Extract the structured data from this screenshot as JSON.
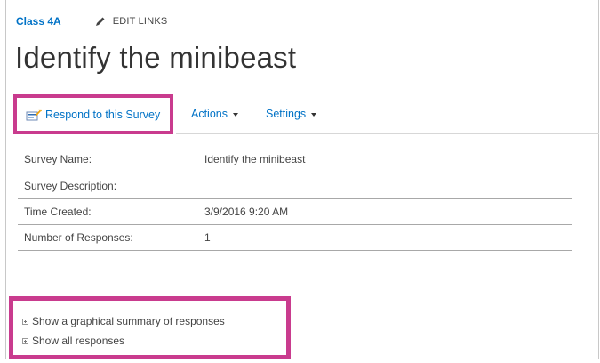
{
  "breadcrumb": {
    "site_link": "Class 4A",
    "edit_links": "EDIT LINKS"
  },
  "page": {
    "title": "Identify the minibeast"
  },
  "toolbar": {
    "respond_label": "Respond to this Survey",
    "actions_label": "Actions",
    "settings_label": "Settings"
  },
  "survey_info": {
    "rows": [
      {
        "label": "Survey Name:",
        "value": "Identify the minibeast"
      },
      {
        "label": "Survey Description:",
        "value": ""
      },
      {
        "label": "Time Created:",
        "value": "3/9/2016 9:20 AM"
      },
      {
        "label": "Number of Responses:",
        "value": "1"
      }
    ]
  },
  "links": {
    "graphical_summary": "Show a graphical summary of responses",
    "all_responses": "Show all responses"
  },
  "colors": {
    "link_blue": "#0072c6",
    "highlight_magenta": "#c93b8e",
    "text": "#444444"
  }
}
